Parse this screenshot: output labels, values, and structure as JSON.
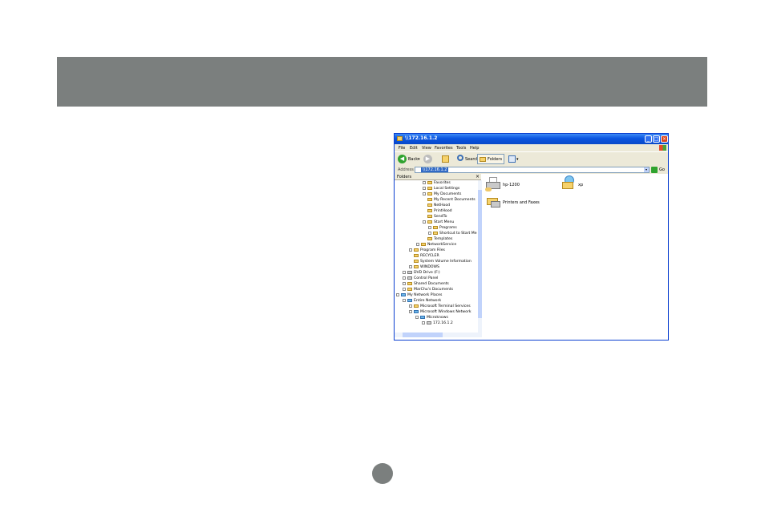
{
  "window": {
    "title": "\\\\172.16.1.2",
    "menu": [
      "File",
      "Edit",
      "View",
      "Favorites",
      "Tools",
      "Help"
    ],
    "toolbar": {
      "back": "Back",
      "search": "Search",
      "folders": "Folders"
    },
    "address": {
      "label": "Address",
      "value": "\\\\172.16.1.2",
      "go": "Go"
    },
    "folders_pane": {
      "title": "Folders",
      "items": [
        "Favorites",
        "Local Settings",
        "My Documents",
        "My Recent Documents",
        "NetHood",
        "PrintHood",
        "SendTo",
        "Start Menu",
        "Programs",
        "Shortcut to Start Me",
        "Templates",
        "NetworkService",
        "Program Files",
        "RECYCLER",
        "System Volume Information",
        "WINDOWS",
        "DVD Drive (F:)",
        "Control Panel",
        "Shared Documents",
        "MarChu's Documents",
        "My Network Places",
        "Entire Network",
        "Microsoft Terminal Services",
        "Microsoft Windows Network",
        "Microknows",
        "172.16.1.2"
      ]
    },
    "content": {
      "items": [
        "hp-1200",
        "xp",
        "Printers and Faxes"
      ]
    }
  },
  "colors": {
    "header_band": "#7b7f7e",
    "title_bar": "#0a55e0",
    "selection": "#316ac5"
  }
}
